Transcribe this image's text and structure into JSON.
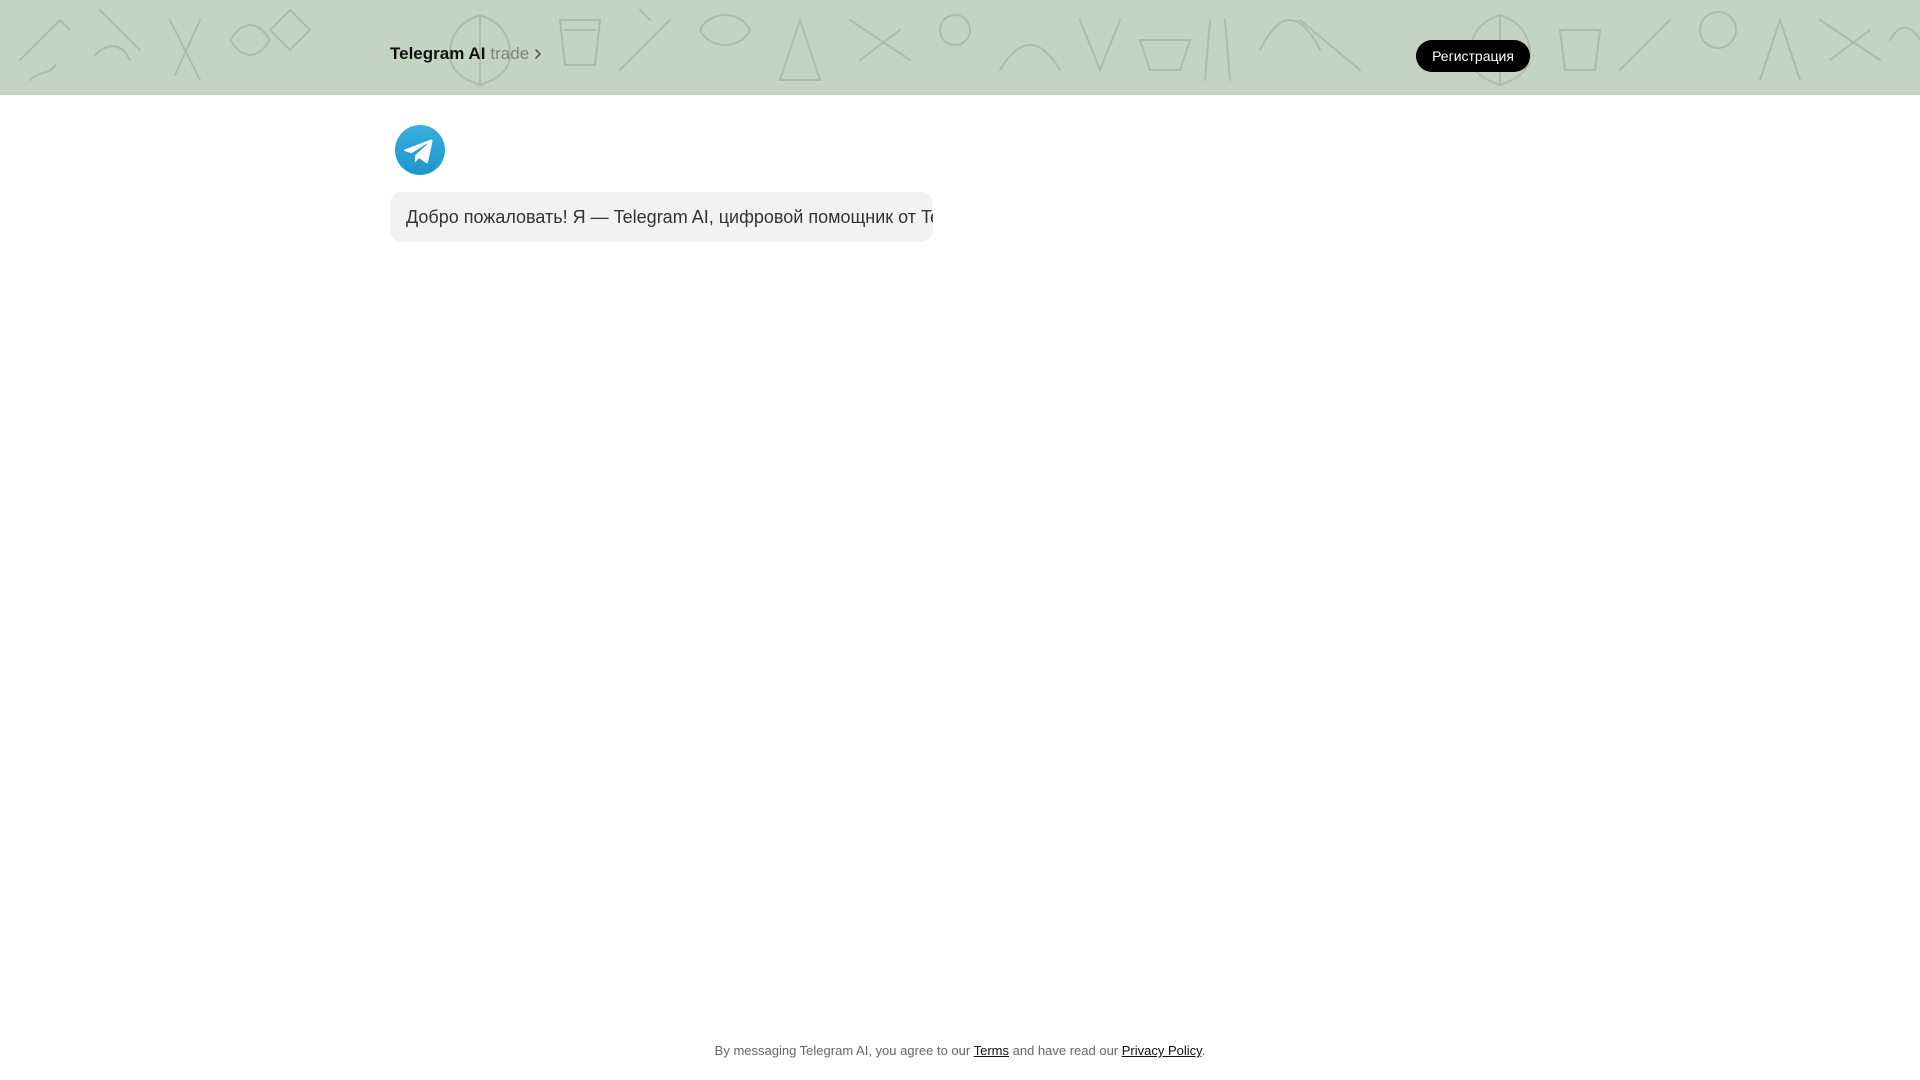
{
  "header": {
    "title": "Telegram AI",
    "subtitle": "trade",
    "register_label": "Регистрация",
    "background_color": "#c4d4c2"
  },
  "chat": {
    "avatar_icon": "telegram-plane-icon",
    "messages": [
      {
        "text": "Добро пожаловать! Я — Telegram AI, цифровой помощник от Te"
      }
    ]
  },
  "footer": {
    "text_before": "By messaging Telegram AI, you agree to our ",
    "terms_label": "Terms",
    "text_middle": " and have read our ",
    "privacy_label": "Privacy Policy",
    "text_after": "."
  },
  "colors": {
    "accent": "#2aa3df",
    "button": "#000000"
  }
}
